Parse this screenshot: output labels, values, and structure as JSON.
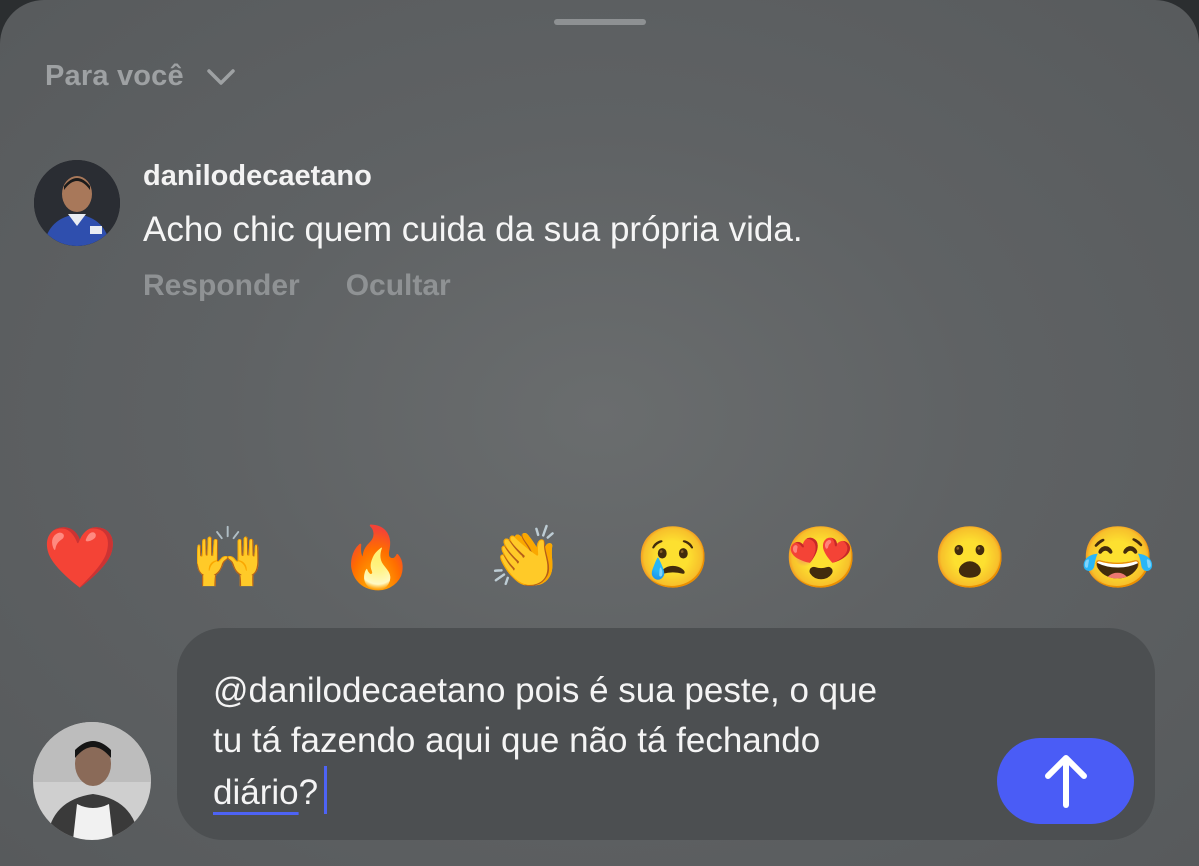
{
  "sheet": {
    "filter_label": "Para você",
    "filter_icon": "chevron-down-icon"
  },
  "comment": {
    "username": "danilodecaetano",
    "text": "Acho chic quem cuida da sua própria vida.",
    "actions": {
      "reply": "Responder",
      "hide": "Ocultar"
    }
  },
  "reactions": [
    "❤️",
    "🙌",
    "🔥",
    "👏",
    "😢",
    "😍",
    "😮",
    "😂"
  ],
  "composer": {
    "line1": "@danilodecaetano pois é sua peste, o que",
    "line2": "tu tá fazendo aqui que não tá fechando",
    "line3_word": "diário",
    "line3_rest": "?",
    "send_icon": "arrow-up-icon",
    "accent_color": "#4a5cf6"
  }
}
